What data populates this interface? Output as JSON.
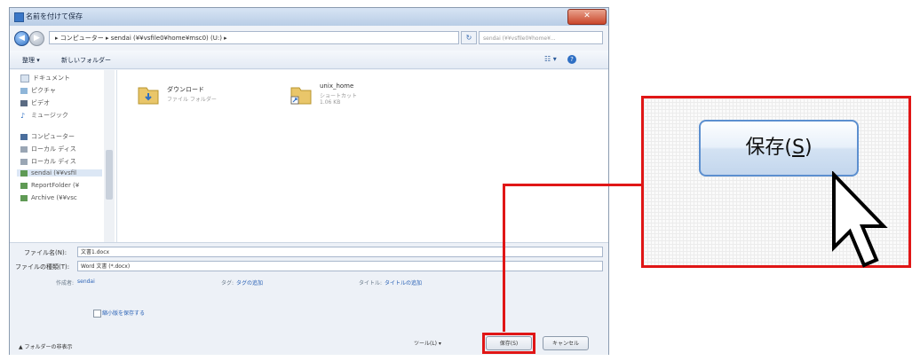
{
  "window": {
    "title": "名前を付けて保存",
    "close": "✕"
  },
  "address": {
    "path": "▸ コンピューター ▸ sendai (¥¥vsfile0¥home¥msc0) (U:) ▸",
    "search_placeholder": "sendai (¥¥vsfile0¥home¥..."
  },
  "toolbar": {
    "organize": "整理 ▾",
    "new_folder": "新しいフォルダー",
    "view": "☷ ▾",
    "help": "?"
  },
  "nav": {
    "items": [
      {
        "label": "ドキュメント",
        "icon": "document-icon"
      },
      {
        "label": "ピクチャ",
        "icon": "picture-icon"
      },
      {
        "label": "ビデオ",
        "icon": "video-icon"
      },
      {
        "label": "ミュージック",
        "icon": "music-icon"
      },
      {
        "label": "コンピューター",
        "icon": "computer-icon"
      },
      {
        "label": "ローカル ディス",
        "icon": "drive-icon"
      },
      {
        "label": "ローカル ディス",
        "icon": "drive-icon"
      },
      {
        "label": "sendai (¥¥vsfil",
        "icon": "network-drive-icon"
      },
      {
        "label": "ReportFolder (¥",
        "icon": "network-drive-icon"
      },
      {
        "label": "Archive (¥¥vsc",
        "icon": "network-drive-icon"
      }
    ]
  },
  "files": [
    {
      "name": "ダウンロード",
      "type": "ファイル フォルダー",
      "size": ""
    },
    {
      "name": "unix_home",
      "type": "ショートカット",
      "size": "1.06 KB"
    }
  ],
  "form": {
    "filename_label": "ファイル名(N):",
    "filename_value": "文書1.docx",
    "filetype_label": "ファイルの種類(T):",
    "filetype_value": "Word 文書 (*.docx)",
    "author_label": "作成者:",
    "author_value": "sendai",
    "tags_label": "タグ:",
    "tags_value": "タグの追加",
    "title_label": "タイトル:",
    "title_value": "タイトルの追加",
    "thumbnail_label": "縮小版を保存する",
    "hide_folders": "▲ フォルダーの非表示",
    "tools": "ツール(L) ▾",
    "save": "保存(S)",
    "cancel": "キャンセル"
  },
  "callout": {
    "save_text": "保存(",
    "save_accel": "S",
    "save_close": ")"
  },
  "colors": {
    "highlight": "#e01616",
    "accent": "#2e6fc4"
  }
}
